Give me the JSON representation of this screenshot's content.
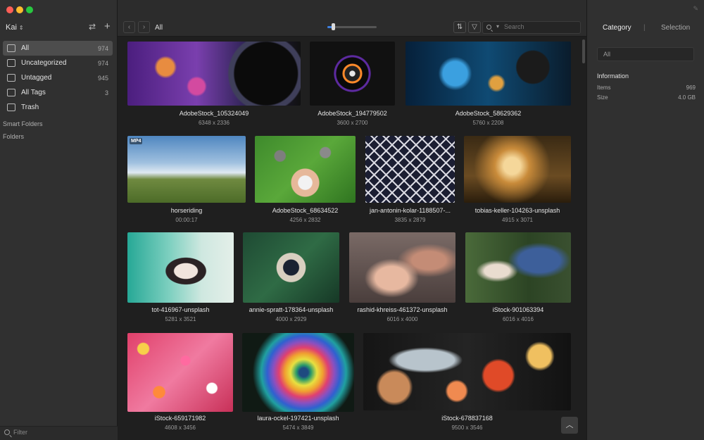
{
  "colors": {
    "sidebar_bg": "#303030",
    "grid_bg": "#1f1f1f",
    "selected_item_bg": "#4d4d4d",
    "accent": "#3c7fe0"
  },
  "sidebar": {
    "library_name": "Kai",
    "icons": {
      "sync": "swap-arrows-icon",
      "add": "plus-icon"
    },
    "items": [
      {
        "label": "All",
        "count": "974",
        "icon": "all-items-icon",
        "selected": true
      },
      {
        "label": "Uncategorized",
        "count": "974",
        "icon": "uncategorized-icon",
        "selected": false
      },
      {
        "label": "Untagged",
        "count": "945",
        "icon": "untagged-icon",
        "selected": false
      },
      {
        "label": "All Tags",
        "count": "3",
        "icon": "tag-icon",
        "selected": false
      },
      {
        "label": "Trash",
        "count": "",
        "icon": "trash-icon",
        "selected": false
      }
    ],
    "sections": {
      "smart_folders": "Smart Folders",
      "folders": "Folders"
    },
    "filter_placeholder": "Filter"
  },
  "toolbar": {
    "back": "‹",
    "forward": "›",
    "breadcrumb": "All",
    "zoom_level": 0.12,
    "sort_icon": "⇅",
    "filter_icon": "▽",
    "search_placeholder": "Search"
  },
  "grid": {
    "items": [
      {
        "name": "AdobeStock_105324049",
        "dims": "6348 x 2336"
      },
      {
        "name": "AdobeStock_194779502",
        "dims": "3600 x 2700"
      },
      {
        "name": "AdobeStock_58629362",
        "dims": "5760 x 2208"
      },
      {
        "name": "horseriding",
        "dims": "00:00:17",
        "badge": "MP4"
      },
      {
        "name": "AdobeStock_68634522",
        "dims": "4256 x 2832"
      },
      {
        "name": "jan-antonin-kolar-1188507-...",
        "dims": "3835 x 2879"
      },
      {
        "name": "tobias-keller-104263-unsplash",
        "dims": "4915 x 3071"
      },
      {
        "name": "tot-416967-unsplash",
        "dims": "5281 x 3521"
      },
      {
        "name": "annie-spratt-178364-unsplash",
        "dims": "4000 x 2929"
      },
      {
        "name": "rashid-khreiss-461372-unsplash",
        "dims": "6016 x 4000"
      },
      {
        "name": "iStock-901063394",
        "dims": "6016 x 4016"
      },
      {
        "name": "iStock-659171982",
        "dims": "4608 x 3456"
      },
      {
        "name": "laura-ockel-197421-unsplash",
        "dims": "5474 x 3849"
      },
      {
        "name": "iStock-678837168",
        "dims": "9500 x 3546"
      }
    ],
    "to_top": "︿"
  },
  "panel": {
    "tabs": [
      "Category",
      "Selection"
    ],
    "separator": "|",
    "search_value": "All",
    "info_title": "Information",
    "info": [
      {
        "label": "Items",
        "value": "969"
      },
      {
        "label": "Size",
        "value": "4.0 GB"
      }
    ]
  }
}
